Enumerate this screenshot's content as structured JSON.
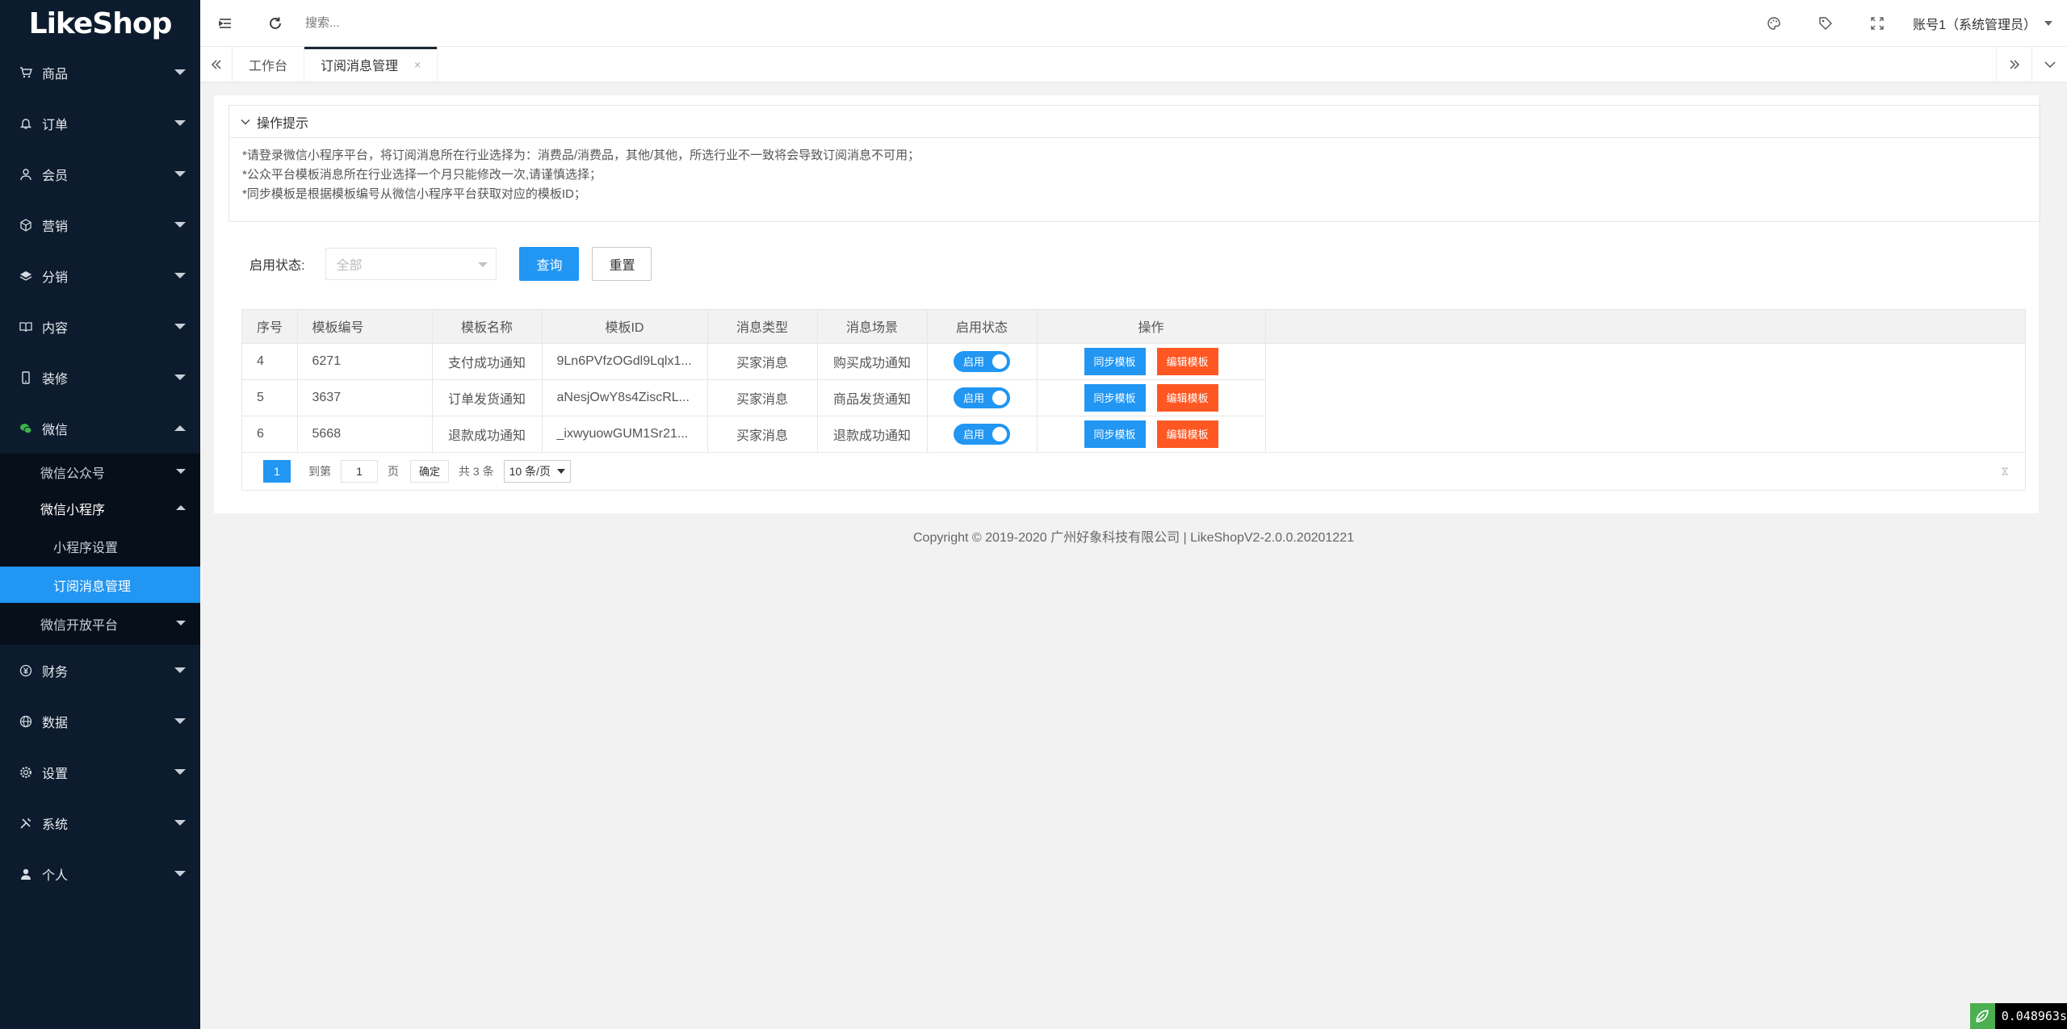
{
  "app": {
    "logo": "LikeShop",
    "search_placeholder": "搜索...",
    "account": "账号1（系统管理员）"
  },
  "sidebar": {
    "items": [
      {
        "label": "商品",
        "icon": "cart-icon"
      },
      {
        "label": "订单",
        "icon": "bell-icon"
      },
      {
        "label": "会员",
        "icon": "user-icon"
      },
      {
        "label": "营销",
        "icon": "cube-icon"
      },
      {
        "label": "分销",
        "icon": "layers-icon"
      },
      {
        "label": "内容",
        "icon": "book-icon"
      },
      {
        "label": "装修",
        "icon": "mobile-icon"
      },
      {
        "label": "微信",
        "icon": "wechat-icon"
      },
      {
        "label": "财务",
        "icon": "yen-icon"
      },
      {
        "label": "数据",
        "icon": "globe-icon"
      },
      {
        "label": "设置",
        "icon": "gear-icon"
      },
      {
        "label": "系统",
        "icon": "tools-icon"
      },
      {
        "label": "个人",
        "icon": "person-icon"
      }
    ],
    "wechat_sub": {
      "official": "微信公众号",
      "mini": "微信小程序",
      "mini_settings": "小程序设置",
      "subscribe_msg": "订阅消息管理",
      "open_platform": "微信开放平台"
    }
  },
  "tabs": {
    "workbench": "工作台",
    "current": "订阅消息管理",
    "close": "×"
  },
  "tips": {
    "title": "操作提示",
    "lines": [
      "*请登录微信小程序平台，将订阅消息所在行业选择为：消费品/消费品，其他/其他，所选行业不一致将会导致订阅消息不可用；",
      "*公众平台模板消息所在行业选择一个月只能修改一次,请谨慎选择；",
      "*同步模板是根据模板编号从微信小程序平台获取对应的模板ID；"
    ]
  },
  "filter": {
    "label": "启用状态:",
    "select_value": "全部",
    "query": "查询",
    "reset": "重置"
  },
  "table": {
    "headers": [
      "序号",
      "模板编号",
      "模板名称",
      "模板ID",
      "消息类型",
      "消息场景",
      "启用状态",
      "操作"
    ],
    "rows": [
      {
        "no": "4",
        "code": "6271",
        "name": "支付成功通知",
        "tid": "9Ln6PVfzOGdl9Lqlx1...",
        "type": "买家消息",
        "scene": "购买成功通知",
        "status": "启用",
        "sync": "同步模板",
        "edit": "编辑模板"
      },
      {
        "no": "5",
        "code": "3637",
        "name": "订单发货通知",
        "tid": "aNesjOwY8s4ZiscRL...",
        "type": "买家消息",
        "scene": "商品发货通知",
        "status": "启用",
        "sync": "同步模板",
        "edit": "编辑模板"
      },
      {
        "no": "6",
        "code": "5668",
        "name": "退款成功通知",
        "tid": "_ixwyuowGUM1Sr21...",
        "type": "买家消息",
        "scene": "退款成功通知",
        "status": "启用",
        "sync": "同步模板",
        "edit": "编辑模板"
      }
    ]
  },
  "pager": {
    "current": "1",
    "goto": "到第",
    "page_input": "1",
    "page_unit": "页",
    "confirm": "确定",
    "total": "共 3 条",
    "page_size": "10 条/页"
  },
  "footer": "Copyright © 2019-2020 广州好象科技有限公司  |  LikeShopV2-2.0.0.20201221",
  "timer": "0.048963s",
  "colors": {
    "sidebar_bg": "#0c1b2d",
    "primary": "#2196f3",
    "danger": "#ff5722"
  }
}
